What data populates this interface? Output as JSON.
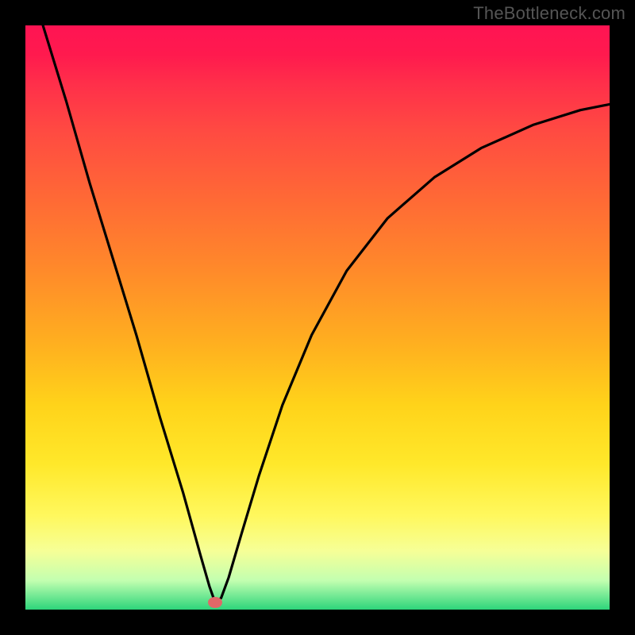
{
  "watermark": "TheBottleneck.com",
  "chart_data": {
    "type": "line",
    "title": "",
    "xlabel": "",
    "ylabel": "",
    "xlim": [
      0,
      1
    ],
    "ylim": [
      0,
      1
    ],
    "series": [
      {
        "name": "curve",
        "x": [
          0.03,
          0.07,
          0.11,
          0.15,
          0.19,
          0.23,
          0.27,
          0.3,
          0.315,
          0.322,
          0.328,
          0.335,
          0.348,
          0.37,
          0.4,
          0.44,
          0.49,
          0.55,
          0.62,
          0.7,
          0.78,
          0.87,
          0.95,
          1.0
        ],
        "y": [
          1.0,
          0.87,
          0.73,
          0.6,
          0.47,
          0.33,
          0.2,
          0.092,
          0.04,
          0.02,
          0.014,
          0.02,
          0.055,
          0.13,
          0.23,
          0.35,
          0.47,
          0.58,
          0.67,
          0.74,
          0.79,
          0.83,
          0.855,
          0.865
        ]
      }
    ],
    "marker": {
      "x": 0.325,
      "y": 0.012
    },
    "gradient_stops": [
      {
        "pct": 0,
        "color": "#ff1453"
      },
      {
        "pct": 55,
        "color": "#ffb11f"
      },
      {
        "pct": 84,
        "color": "#fff85e"
      },
      {
        "pct": 100,
        "color": "#2dd57b"
      }
    ]
  }
}
